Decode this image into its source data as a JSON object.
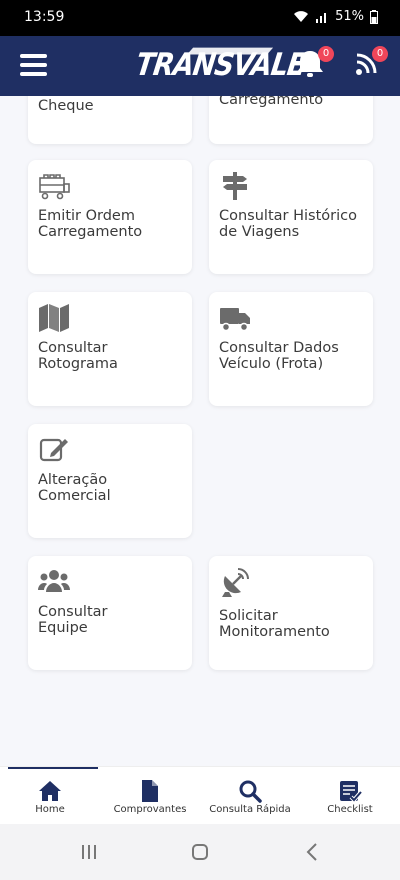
{
  "status": {
    "time": "13:59",
    "battery": "51%"
  },
  "header": {
    "logo": "TRANSVALE",
    "notifications_count": "0",
    "feed_count": "0"
  },
  "cards": [
    {
      "label": "Cheque",
      "icon": "cheque-icon"
    },
    {
      "label": "Carregamento",
      "icon": "truck-loading-icon"
    },
    {
      "label": "Emitir Ordem\nCarregamento",
      "icon": "pallet-truck-icon"
    },
    {
      "label": "Consultar Histórico\nde Viagens",
      "icon": "signpost-icon"
    },
    {
      "label": "Consultar\nRotograma",
      "icon": "map-icon"
    },
    {
      "label": "Consultar Dados\nVeículo (Frota)",
      "icon": "truck-icon"
    },
    {
      "label": "Alteração\nComercial",
      "icon": "edit-icon"
    },
    {
      "label": "Consultar\nEquipe",
      "icon": "users-icon"
    },
    {
      "label": "Solicitar\nMonitoramento",
      "icon": "satellite-dish-icon"
    }
  ],
  "bottom_nav": [
    {
      "label": "Home",
      "icon": "home-icon"
    },
    {
      "label": "Comprovantes",
      "icon": "file-icon"
    },
    {
      "label": "Consulta Rápida",
      "icon": "search-icon"
    },
    {
      "label": "Checklist",
      "icon": "checklist-icon"
    }
  ],
  "colors": {
    "brand": "#1f2f63",
    "badge": "#f0465a",
    "icon": "#6b6b6b"
  }
}
